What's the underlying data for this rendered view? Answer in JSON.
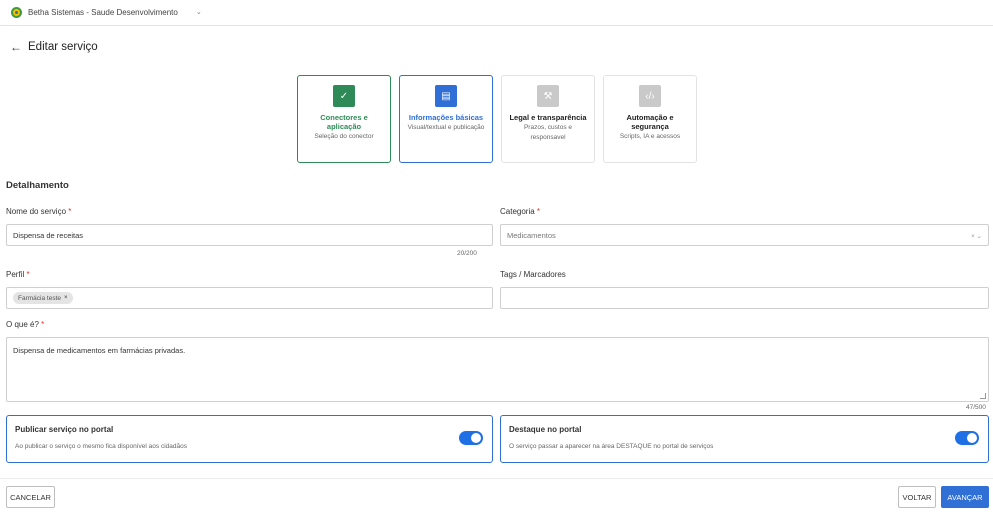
{
  "topbar": {
    "app_name": "Betha Sistemas - Saude Desenvolvimento",
    "chevron": "⌄"
  },
  "page": {
    "back_icon": "←",
    "title": "Editar serviço"
  },
  "steps": [
    {
      "icon": "✓",
      "title_line1": "Conectores e",
      "title_line2": "aplicação",
      "subtitle": "Seleção do conector",
      "state": "done"
    },
    {
      "icon": "▤",
      "title_line1": "Informações básicas",
      "title_line2": "",
      "subtitle": "Visual/textual e publicação",
      "state": "active"
    },
    {
      "icon": "⚒",
      "title_line1": "Legal e transparência",
      "title_line2": "",
      "subtitle": "Prazos, custos e responsavel",
      "state": "todo"
    },
    {
      "icon": "‹/›",
      "title_line1": "Automação e",
      "title_line2": "segurança",
      "subtitle": "Scripts, IA e acessos",
      "state": "todo"
    }
  ],
  "section": {
    "title": "Detalhamento"
  },
  "form": {
    "service_name": {
      "label": "Nome do serviço",
      "required": "*",
      "value": "Dispensa de receitas",
      "counter": "20/200"
    },
    "category": {
      "label": "Categoria",
      "required": "*",
      "value": "Medicamentos",
      "clear_icon": "×",
      "chevron": "⌄"
    },
    "profile": {
      "label": "Perfil",
      "required": "*",
      "chip": "Farmácia teste",
      "chip_remove": "×"
    },
    "tags": {
      "label": "Tags / Marcadores",
      "value": ""
    },
    "what_is": {
      "label": "O que é?",
      "required": "*",
      "value": "Dispensa de medicamentos em farmácias privadas.",
      "counter": "47/500"
    }
  },
  "cards": {
    "publish": {
      "title": "Publicar serviço no portal",
      "subtitle": "Ao publicar o serviço o mesmo fica disponível aos cidadãos",
      "enabled": true
    },
    "highlight": {
      "title": "Destaque no portal",
      "subtitle": "O serviço passar a aparecer na área DESTAQUE no portal de serviços",
      "enabled": true
    }
  },
  "footer": {
    "cancel_label": "CANCELAR",
    "back_label": "VOLTAR",
    "next_label": "AVANÇAR"
  },
  "colors": {
    "primary": "#2f6fd6",
    "success": "#2e8b57",
    "required": "#d9342b"
  }
}
